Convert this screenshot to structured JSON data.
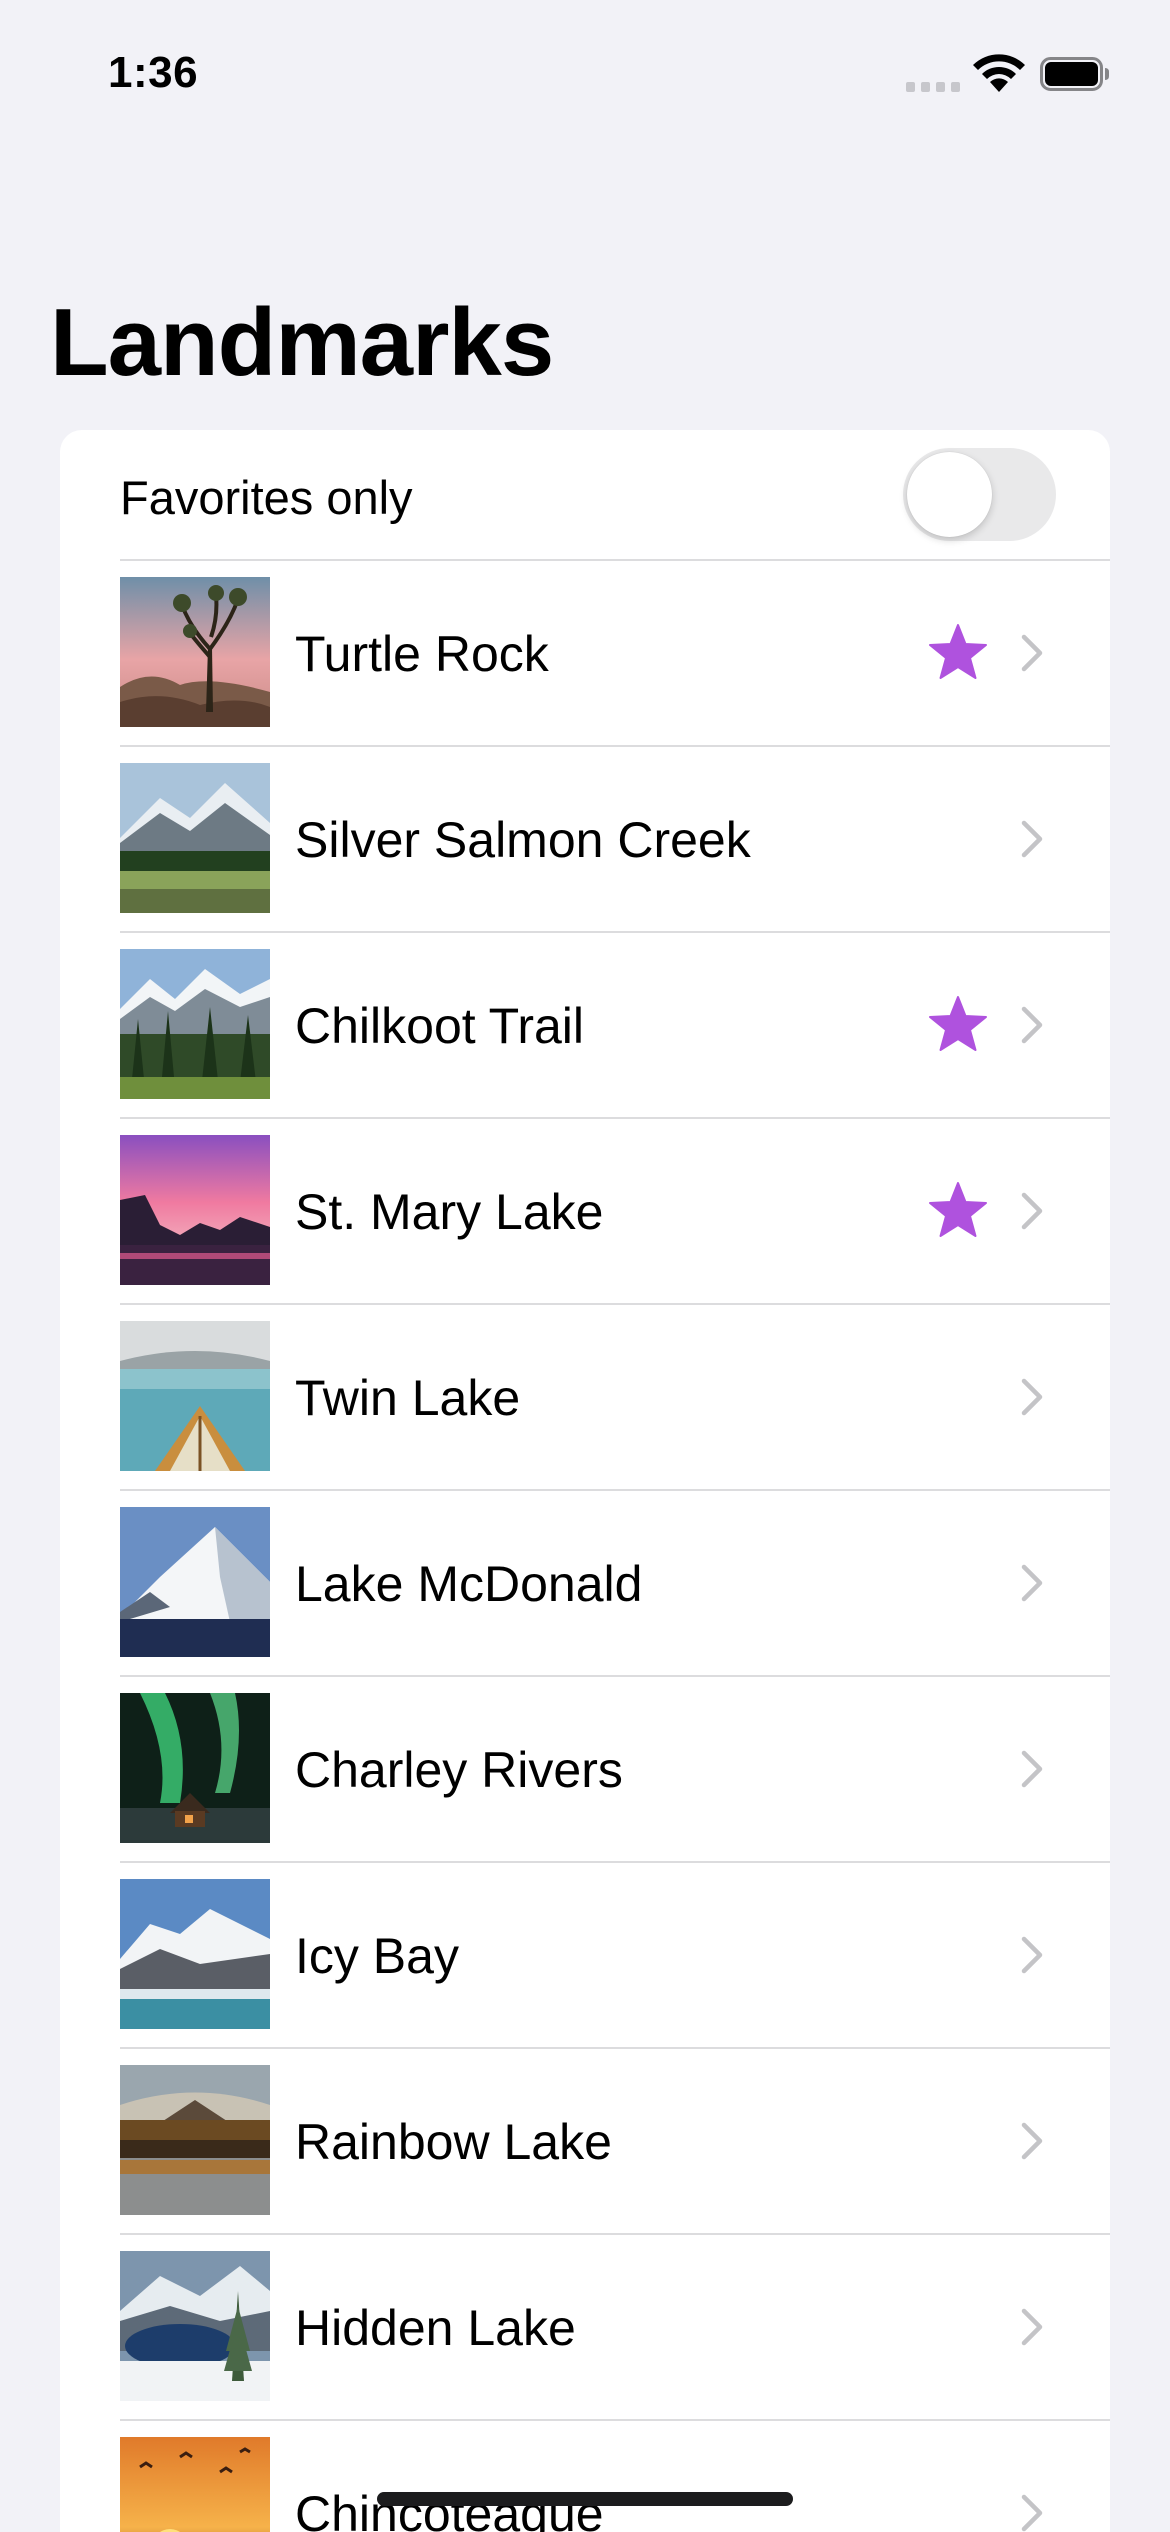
{
  "status_bar": {
    "time": "1:36"
  },
  "nav": {
    "title": "Landmarks"
  },
  "filter": {
    "label": "Favorites only",
    "toggle_on": false
  },
  "colors": {
    "favorite_star": "#af52de",
    "chevron": "#c4c4c7",
    "background": "#f2f2f7"
  },
  "landmarks": [
    {
      "name": "Turtle Rock",
      "favorite": true,
      "thumbnail": "joshua-tree-desert"
    },
    {
      "name": "Silver Salmon Creek",
      "favorite": false,
      "thumbnail": "mountain-meadow"
    },
    {
      "name": "Chilkoot Trail",
      "favorite": true,
      "thumbnail": "forest-mountains"
    },
    {
      "name": "St. Mary Lake",
      "favorite": true,
      "thumbnail": "pink-sunset-lake"
    },
    {
      "name": "Twin Lake",
      "favorite": false,
      "thumbnail": "canoe-on-lake"
    },
    {
      "name": "Lake McDonald",
      "favorite": false,
      "thumbnail": "snowy-peak"
    },
    {
      "name": "Charley Rivers",
      "favorite": false,
      "thumbnail": "northern-lights-cabin"
    },
    {
      "name": "Icy Bay",
      "favorite": false,
      "thumbnail": "glacier-bay"
    },
    {
      "name": "Rainbow Lake",
      "favorite": false,
      "thumbnail": "lake-reflection"
    },
    {
      "name": "Hidden Lake",
      "favorite": false,
      "thumbnail": "snowy-lake-tree"
    },
    {
      "name": "Chincoteague",
      "favorite": false,
      "thumbnail": "sunset-birds"
    }
  ]
}
